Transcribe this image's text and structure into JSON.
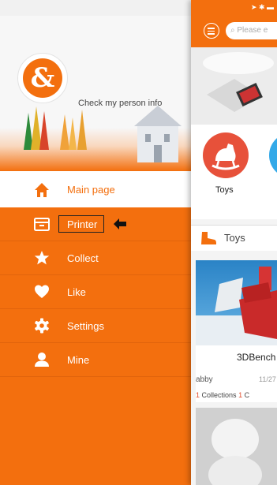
{
  "drawer": {
    "profile": {
      "link_label": "Check my person info",
      "logo_glyph": "&"
    },
    "menu": [
      {
        "label": "Main page",
        "icon": "home-icon"
      },
      {
        "label": "Printer",
        "icon": "printer-icon"
      },
      {
        "label": "Collect",
        "icon": "star-icon"
      },
      {
        "label": "Like",
        "icon": "heart-icon"
      },
      {
        "label": "Settings",
        "icon": "gear-icon"
      },
      {
        "label": "Mine",
        "icon": "person-icon"
      }
    ],
    "selected_index": 0
  },
  "panel": {
    "search_placeholder": "Please e",
    "categories": [
      {
        "label": "Toys",
        "icon": "rocking-horse-icon"
      }
    ],
    "section": {
      "title": "Toys",
      "icon": "boot-icon"
    },
    "card": {
      "title": "3DBench",
      "user": "abby",
      "date": "11/27",
      "collections": "1",
      "collections_label": "Collections",
      "second_stat": "1",
      "second_stat_label": "C"
    }
  },
  "colors": {
    "accent": "#f36f0e",
    "category_toys": "#e7513a",
    "category_next": "#33a9e8"
  }
}
